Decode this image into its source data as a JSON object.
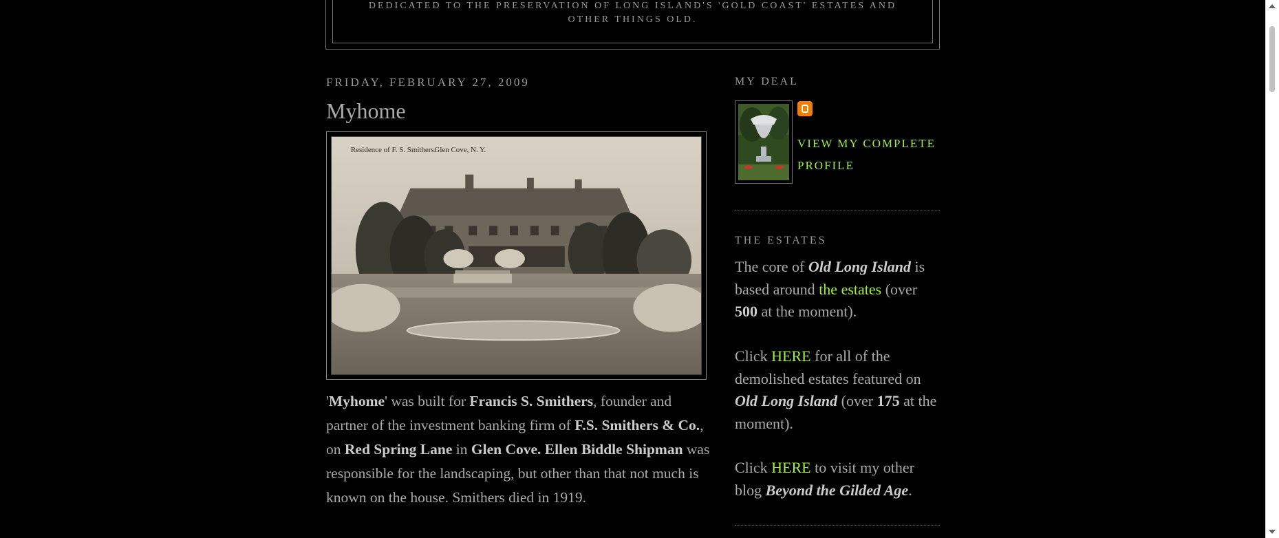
{
  "header": {
    "tagline_line1": "Dedicated to the preservation of Long Island's 'Gold Coast' estates and",
    "tagline_line2": "other things old."
  },
  "post": {
    "date": "Friday, February 27, 2009",
    "title": "Myhome",
    "image_caption_left": "Residence of F. S. Smithers.",
    "image_caption_right": "Glen Cove, N. Y.",
    "body": {
      "t1": "'",
      "b1": "Myhome",
      "t2": "' was built for ",
      "b2": "Francis S. Smithers",
      "t3": ", founder and partner of the investment banking firm of ",
      "b3": "F.S. Smithers & Co.",
      "t4": ", on ",
      "b4": "Red Spring Lane",
      "t5": " in ",
      "b5": "Glen Cove.",
      "t6": " ",
      "b6": "Ellen Biddle Shipman",
      "t7": " was responsible for the landscaping, but other than that not much is known on the house. Smithers died in 1919."
    }
  },
  "sidebar": {
    "my_deal": {
      "title": "My Deal",
      "profile_link": "View my complete profile",
      "blogger_icon": "blogger-icon"
    },
    "estates": {
      "title": "The Estates",
      "p1_t1": "The core of ",
      "p1_i1": "Old Long Island",
      "p1_t2": " is based around ",
      "p1_link": "the estates",
      "p1_t3": " (over ",
      "p1_b1": "500",
      "p1_t4": " at the moment).",
      "p2_t1": "Click ",
      "p2_link": "HERE",
      "p2_t2": " for all of the demolished estates featured on ",
      "p2_i1": "Old Long Island",
      "p2_t3": " (over ",
      "p2_b1": "175",
      "p2_t4": " at the moment).",
      "p3_t1": "Click ",
      "p3_link": "HERE",
      "p3_t2": " to visit my other blog ",
      "p3_i1": "Beyond the Gilded Age",
      "p3_t3": "."
    }
  },
  "colors": {
    "background": "#000000",
    "text": "#aaaaaa",
    "link": "#9ff13b",
    "blogger_orange": "#f57d00"
  }
}
